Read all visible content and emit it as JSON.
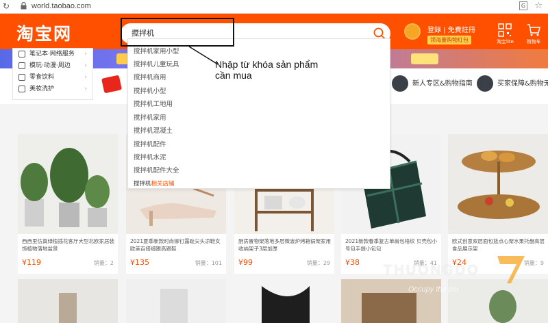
{
  "browser": {
    "url": "world.taobao.com"
  },
  "header": {
    "logo": "淘宝网",
    "search_value": "搅拌机",
    "login": "登錄",
    "register": "免費註冊",
    "coupon": "领海量购物红包",
    "icons": [
      {
        "name": "qr-code-icon",
        "label": "淘宝lite"
      },
      {
        "name": "cart-icon",
        "label": "购物车"
      }
    ]
  },
  "categories": [
    {
      "label": "笔记本·网络服务"
    },
    {
      "label": "模玩·动漫·周边"
    },
    {
      "label": "零食饮料"
    },
    {
      "label": "美妆洗护"
    }
  ],
  "services": [
    {
      "label": "新人专区&购物指南"
    },
    {
      "label": "买家保障&购物无忧"
    }
  ],
  "suggestions": [
    "搅拌机家用小型",
    "搅拌机儿童玩具",
    "搅拌机商用",
    "搅拌机小型",
    "搅拌机工地用",
    "搅拌机家用",
    "搅拌机混凝土",
    "搅拌机配件",
    "搅拌机水泥",
    "搅拌机配件大全"
  ],
  "shop_suggestion": {
    "prefix": "搅拌机",
    "suffix": "相关店铺"
  },
  "annotation": {
    "line1": "Nhập từ khóa sản phẩm",
    "line2": "cần mua"
  },
  "products": [
    {
      "title": "西西里仿真绿植插花客厅大型北欧家居装饰植物落地盆景",
      "price": "¥119",
      "sold_label": "销量：",
      "sold": "2"
    },
    {
      "title": "2021夏季新款时尚铆钉露趾尖头凉鞋女欧美百搭细跟高跟鞋",
      "price": "¥135",
      "sold_label": "销量：",
      "sold": "101"
    },
    {
      "title": "厨房置物架落地多层微波炉烤箱锅架家用收纳架子3层加厚",
      "price": "¥99",
      "sold_label": "销量：",
      "sold": "29"
    },
    {
      "title": "2021新款春季复古单肩包格纹 贝壳包小号包手提小包包",
      "price": "¥38",
      "sold_label": "销量：",
      "sold": "41"
    },
    {
      "title": "欧式创意双层面包篮点心架水果托盘高层食品展示架",
      "price": "¥24",
      "sold_label": "销量：",
      "sold": "9"
    }
  ],
  "watermark": {
    "brand": "THUONGDO",
    "sub": "Occupy the pin"
  }
}
